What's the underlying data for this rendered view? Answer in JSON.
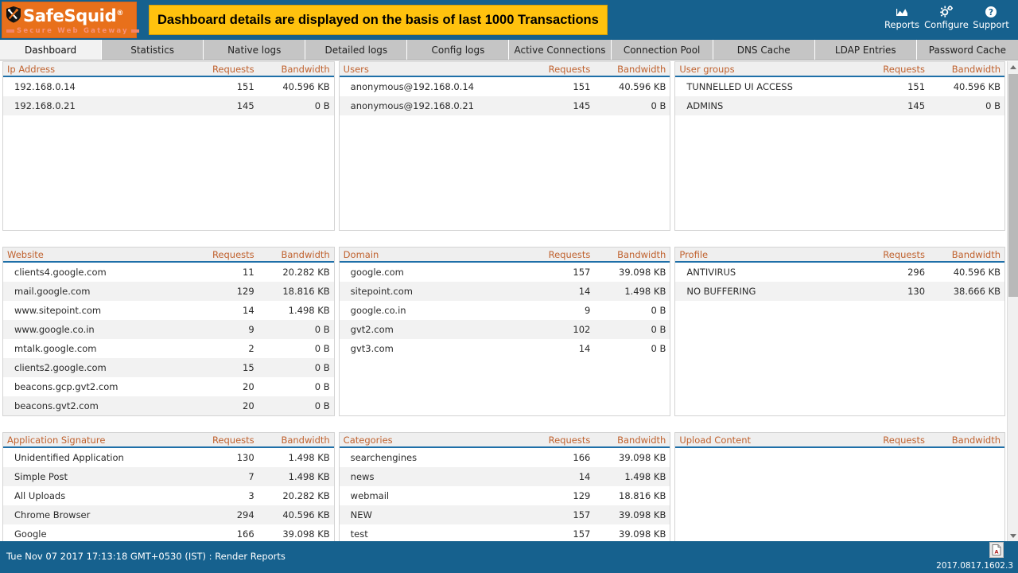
{
  "header": {
    "logo": {
      "name": "SafeSquid",
      "registered": "®",
      "tagline": "Secure Web Gateway",
      "shield_icon": "shield-icon",
      "bg_color": "#e8701b"
    },
    "banner": {
      "text": "Dashboard details are displayed on the basis of last 1000 Transactions",
      "bg_color": "#ffc20e"
    },
    "bg_color": "#16618e",
    "actions": [
      {
        "label": "Reports",
        "icon": "chart-area-icon"
      },
      {
        "label": "Configure",
        "icon": "gear-icon"
      },
      {
        "label": "Support",
        "icon": "question-circle-icon"
      }
    ]
  },
  "tabs": [
    {
      "label": "Dashboard",
      "active": true
    },
    {
      "label": "Statistics",
      "active": false
    },
    {
      "label": "Native logs",
      "active": false
    },
    {
      "label": "Detailed logs",
      "active": false
    },
    {
      "label": "Config logs",
      "active": false
    },
    {
      "label": "Active Connections",
      "active": false
    },
    {
      "label": "Connection Pool",
      "active": false
    },
    {
      "label": "DNS Cache",
      "active": false
    },
    {
      "label": "LDAP Entries",
      "active": false
    },
    {
      "label": "Password Cache",
      "active": false
    }
  ],
  "columns": {
    "requests": "Requests",
    "bandwidth": "Bandwidth"
  },
  "panels": [
    {
      "title": "Ip Address",
      "rows": [
        {
          "name": "192.168.0.14",
          "requests": "151",
          "bandwidth": "40.596 KB"
        },
        {
          "name": "192.168.0.21",
          "requests": "145",
          "bandwidth": "0 B"
        }
      ]
    },
    {
      "title": "Users",
      "rows": [
        {
          "name": "anonymous@192.168.0.14",
          "requests": "151",
          "bandwidth": "40.596 KB"
        },
        {
          "name": "anonymous@192.168.0.21",
          "requests": "145",
          "bandwidth": "0 B"
        }
      ]
    },
    {
      "title": "User groups",
      "rows": [
        {
          "name": "TUNNELLED UI ACCESS",
          "requests": "151",
          "bandwidth": "40.596 KB"
        },
        {
          "name": "ADMINS",
          "requests": "145",
          "bandwidth": "0 B"
        }
      ]
    },
    {
      "title": "Website",
      "rows": [
        {
          "name": "clients4.google.com",
          "requests": "11",
          "bandwidth": "20.282 KB"
        },
        {
          "name": "mail.google.com",
          "requests": "129",
          "bandwidth": "18.816 KB"
        },
        {
          "name": "www.sitepoint.com",
          "requests": "14",
          "bandwidth": "1.498 KB"
        },
        {
          "name": "www.google.co.in",
          "requests": "9",
          "bandwidth": "0 B"
        },
        {
          "name": "mtalk.google.com",
          "requests": "2",
          "bandwidth": "0 B"
        },
        {
          "name": "clients2.google.com",
          "requests": "15",
          "bandwidth": "0 B"
        },
        {
          "name": "beacons.gcp.gvt2.com",
          "requests": "20",
          "bandwidth": "0 B"
        },
        {
          "name": "beacons.gvt2.com",
          "requests": "20",
          "bandwidth": "0 B"
        }
      ]
    },
    {
      "title": "Domain",
      "rows": [
        {
          "name": "google.com",
          "requests": "157",
          "bandwidth": "39.098 KB"
        },
        {
          "name": "sitepoint.com",
          "requests": "14",
          "bandwidth": "1.498 KB"
        },
        {
          "name": "google.co.in",
          "requests": "9",
          "bandwidth": "0 B"
        },
        {
          "name": "gvt2.com",
          "requests": "102",
          "bandwidth": "0 B"
        },
        {
          "name": "gvt3.com",
          "requests": "14",
          "bandwidth": "0 B"
        }
      ]
    },
    {
      "title": "Profile",
      "rows": [
        {
          "name": "ANTIVIRUS",
          "requests": "296",
          "bandwidth": "40.596 KB"
        },
        {
          "name": "NO BUFFERING",
          "requests": "130",
          "bandwidth": "38.666 KB"
        }
      ]
    },
    {
      "title": "Application Signature",
      "rows": [
        {
          "name": "Unidentified Application",
          "requests": "130",
          "bandwidth": "1.498 KB"
        },
        {
          "name": "Simple Post",
          "requests": "7",
          "bandwidth": "1.498 KB"
        },
        {
          "name": "All Uploads",
          "requests": "3",
          "bandwidth": "20.282 KB"
        },
        {
          "name": "Chrome Browser",
          "requests": "294",
          "bandwidth": "40.596 KB"
        },
        {
          "name": "Google",
          "requests": "166",
          "bandwidth": "39.098 KB"
        }
      ]
    },
    {
      "title": "Categories",
      "rows": [
        {
          "name": "searchengines",
          "requests": "166",
          "bandwidth": "39.098 KB"
        },
        {
          "name": "news",
          "requests": "14",
          "bandwidth": "1.498 KB"
        },
        {
          "name": "webmail",
          "requests": "129",
          "bandwidth": "18.816 KB"
        },
        {
          "name": "NEW",
          "requests": "157",
          "bandwidth": "39.098 KB"
        },
        {
          "name": "test",
          "requests": "157",
          "bandwidth": "39.098 KB"
        }
      ]
    },
    {
      "title": "Upload Content",
      "rows": []
    }
  ],
  "footer": {
    "status": "Tue Nov 07 2017 17:13:18 GMT+0530 (IST) : Render Reports",
    "version": "2017.0817.1602.3",
    "export_icon": "pdf-export-icon",
    "bg_color": "#16618e"
  }
}
